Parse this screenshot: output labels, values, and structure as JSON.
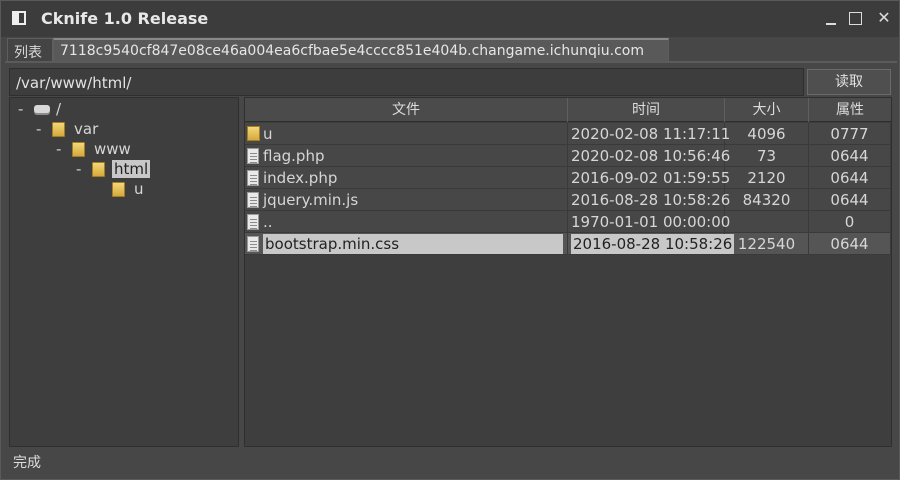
{
  "window": {
    "title": "Cknife 1.0 Release",
    "close_glyph": "✕"
  },
  "tabs": [
    {
      "label": "列表"
    },
    {
      "label": "7118c9540cf847e08ce46a004ea6cfbae5e4cccc851e404b.changame.ichunqiu.com"
    }
  ],
  "pathbar": {
    "value": "/var/www/html/",
    "read_label": "读取"
  },
  "tree": [
    {
      "label": "/",
      "icon": "disk-icon",
      "expander": "-"
    },
    {
      "label": "var",
      "icon": "folder-icon",
      "expander": "-"
    },
    {
      "label": "www",
      "icon": "folder-icon",
      "expander": "-"
    },
    {
      "label": "html",
      "icon": "folder-icon",
      "expander": "-",
      "selected": true
    },
    {
      "label": "u",
      "icon": "folder-icon",
      "expander": ""
    }
  ],
  "table": {
    "columns": [
      "文件",
      "时间",
      "大小",
      "属性"
    ],
    "rows": [
      {
        "name": "u",
        "time": "2020-02-08 11:17:11",
        "size": "4096",
        "attr": "0777",
        "icon": "folder-icon"
      },
      {
        "name": "flag.php",
        "time": "2020-02-08 10:56:46",
        "size": "73",
        "attr": "0644",
        "icon": "file-icon"
      },
      {
        "name": "index.php",
        "time": "2016-09-02 01:59:55",
        "size": "2120",
        "attr": "0644",
        "icon": "file-icon"
      },
      {
        "name": "jquery.min.js",
        "time": "2016-08-28 10:58:26",
        "size": "84320",
        "attr": "0644",
        "icon": "file-icon"
      },
      {
        "name": "..",
        "time": "1970-01-01 00:00:00",
        "size": "",
        "attr": "0",
        "icon": "file-icon"
      },
      {
        "name": "bootstrap.min.css",
        "time": "2016-08-28 10:58:26",
        "size": "122540",
        "attr": "0644",
        "icon": "file-icon",
        "selected": true
      }
    ]
  },
  "status": {
    "text": "完成"
  }
}
